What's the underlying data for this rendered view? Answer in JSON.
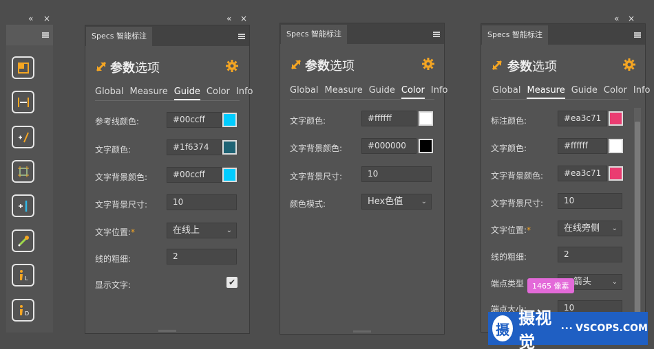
{
  "toolbar": {
    "collapse_glyph": "«",
    "close_glyph": "×",
    "buttons": [
      {
        "icon": "artboard-icon"
      },
      {
        "icon": "measure-width-icon"
      },
      {
        "icon": "plus-slash-icon"
      },
      {
        "icon": "crop-select-icon"
      },
      {
        "icon": "plus-guide-icon"
      },
      {
        "icon": "eyedropper-icon"
      },
      {
        "icon": "info-l-icon"
      },
      {
        "icon": "info-d-icon"
      }
    ]
  },
  "panel_guide": {
    "collapse_glyph": "«",
    "close_glyph": "×",
    "tab_label": "Specs 智能标注",
    "title_bold": "参数",
    "title_light": "选项",
    "nav_tabs": [
      "Global",
      "Measure",
      "Guide",
      "Color",
      "Info"
    ],
    "active_tab": "Guide",
    "rows": {
      "guide_color_label": "参考线颜色:",
      "guide_color_value": "#00ccff",
      "guide_color_hex": "#00ccff",
      "text_color_label": "文字颜色:",
      "text_color_value": "#1f6374",
      "text_color_hex": "#1f6374",
      "text_bg_color_label": "文字背景颜色:",
      "text_bg_color_value": "#00ccff",
      "text_bg_color_hex": "#00ccff",
      "text_bg_size_label": "文字背景尺寸:",
      "text_bg_size_value": "10",
      "text_position_label": "文字位置:",
      "text_position_required": "*",
      "text_position_value": "在线上",
      "line_width_label": "线的粗细:",
      "line_width_value": "2",
      "show_text_label": "显示文字:",
      "show_text_checked": true,
      "check_glyph": "✔"
    }
  },
  "panel_color": {
    "collapse_glyph": "«",
    "close_glyph": "×",
    "tab_label": "Specs 智能标注",
    "title_bold": "参数",
    "title_light": "选项",
    "nav_tabs": [
      "Global",
      "Measure",
      "Guide",
      "Color",
      "Info"
    ],
    "active_tab": "Color",
    "rows": {
      "text_color_label": "文字颜色:",
      "text_color_value": "#ffffff",
      "text_color_hex": "#ffffff",
      "text_bg_color_label": "文字背景颜色:",
      "text_bg_color_value": "#000000",
      "text_bg_color_hex": "#000000",
      "text_bg_size_label": "文字背景尺寸:",
      "text_bg_size_value": "10",
      "color_mode_label": "颜色模式:",
      "color_mode_value": "Hex色值"
    }
  },
  "panel_measure": {
    "collapse_glyph": "«",
    "close_glyph": "×",
    "tab_label": "Specs 智能标注",
    "title_bold": "参数",
    "title_light": "选项",
    "nav_tabs": [
      "Global",
      "Measure",
      "Guide",
      "Color",
      "Info"
    ],
    "active_tab": "Measure",
    "rows": {
      "mark_color_label": "标注颜色:",
      "mark_color_value": "#ea3c71",
      "mark_color_hex": "#ea3c71",
      "text_color_label": "文字颜色:",
      "text_color_value": "#ffffff",
      "text_color_hex": "#ffffff",
      "text_bg_color_label": "文字背景颜色:",
      "text_bg_color_value": "#ea3c71",
      "text_bg_color_hex": "#ea3c71",
      "text_bg_size_label": "文字背景尺寸:",
      "text_bg_size_value": "10",
      "text_position_label": "文字位置:",
      "text_position_required": "*",
      "text_position_value": "在线旁侧",
      "line_width_label": "线的粗细:",
      "line_width_value": "2",
      "endpoint_type_label": "端点类型",
      "endpoint_type_value": "箭头",
      "endpoint_size_label": "端点大小:",
      "endpoint_size_value": "10"
    },
    "tooltip": "1465 像素"
  },
  "colors": {
    "accent_orange": "#f5a623",
    "tooltip_pink": "#e36ad9",
    "watermark_blue": "#1f5fc3"
  },
  "watermark": {
    "logo_char": "摄",
    "brand": "摄视觉",
    "dots": "•••",
    "site": "VSCOPS.COM"
  }
}
